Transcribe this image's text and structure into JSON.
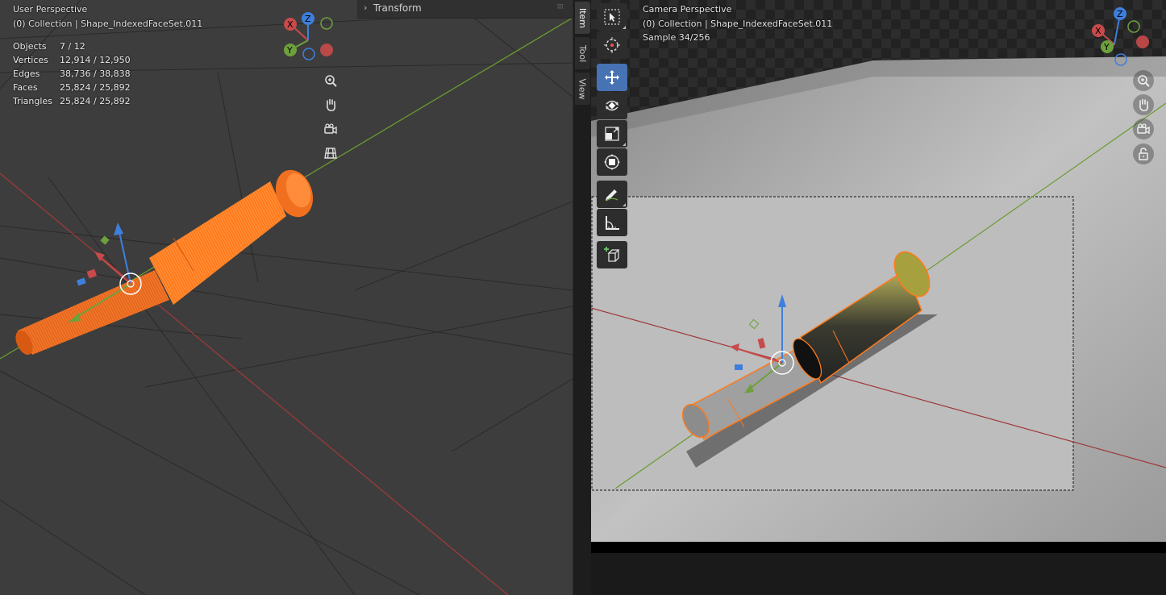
{
  "left_viewport": {
    "title": "User Perspective",
    "collection": "(0) Collection | Shape_IndexedFaceSet.011",
    "stats": [
      {
        "label": "Objects",
        "value": "7 / 12"
      },
      {
        "label": "Vertices",
        "value": "12,914 / 12,950"
      },
      {
        "label": "Edges",
        "value": "38,736 / 38,838"
      },
      {
        "label": "Faces",
        "value": "25,824 / 25,892"
      },
      {
        "label": "Triangles",
        "value": "25,824 / 25,892"
      }
    ],
    "gizmo": {
      "x": "X",
      "y": "Y",
      "z": "Z"
    },
    "nav_icons": [
      "zoom-icon",
      "hand-pan-icon",
      "camera-view-icon",
      "grid-ortho-icon"
    ]
  },
  "n_panel": {
    "section": "Transform"
  },
  "sidebar_tabs": [
    "Item",
    "Tool",
    "View"
  ],
  "toolbar": [
    "select-box",
    "cursor",
    "move",
    "rotate",
    "scale",
    "transform",
    "annotate",
    "measure",
    "add-cube"
  ],
  "right_viewport": {
    "title": "Camera Perspective",
    "collection": "(0) Collection | Shape_IndexedFaceSet.011",
    "sample": "Sample 34/256",
    "gizmo": {
      "x": "X",
      "y": "Y",
      "z": "Z"
    },
    "nav_icons": [
      "zoom-icon",
      "hand-pan-icon",
      "camera-view-icon",
      "lock-icon"
    ]
  },
  "colors": {
    "axis_x": "#c84a4a",
    "axis_y": "#6ea03c",
    "axis_z": "#3f7fdc",
    "selection": "#ff7a1a",
    "active_tool": "#4772b3"
  }
}
